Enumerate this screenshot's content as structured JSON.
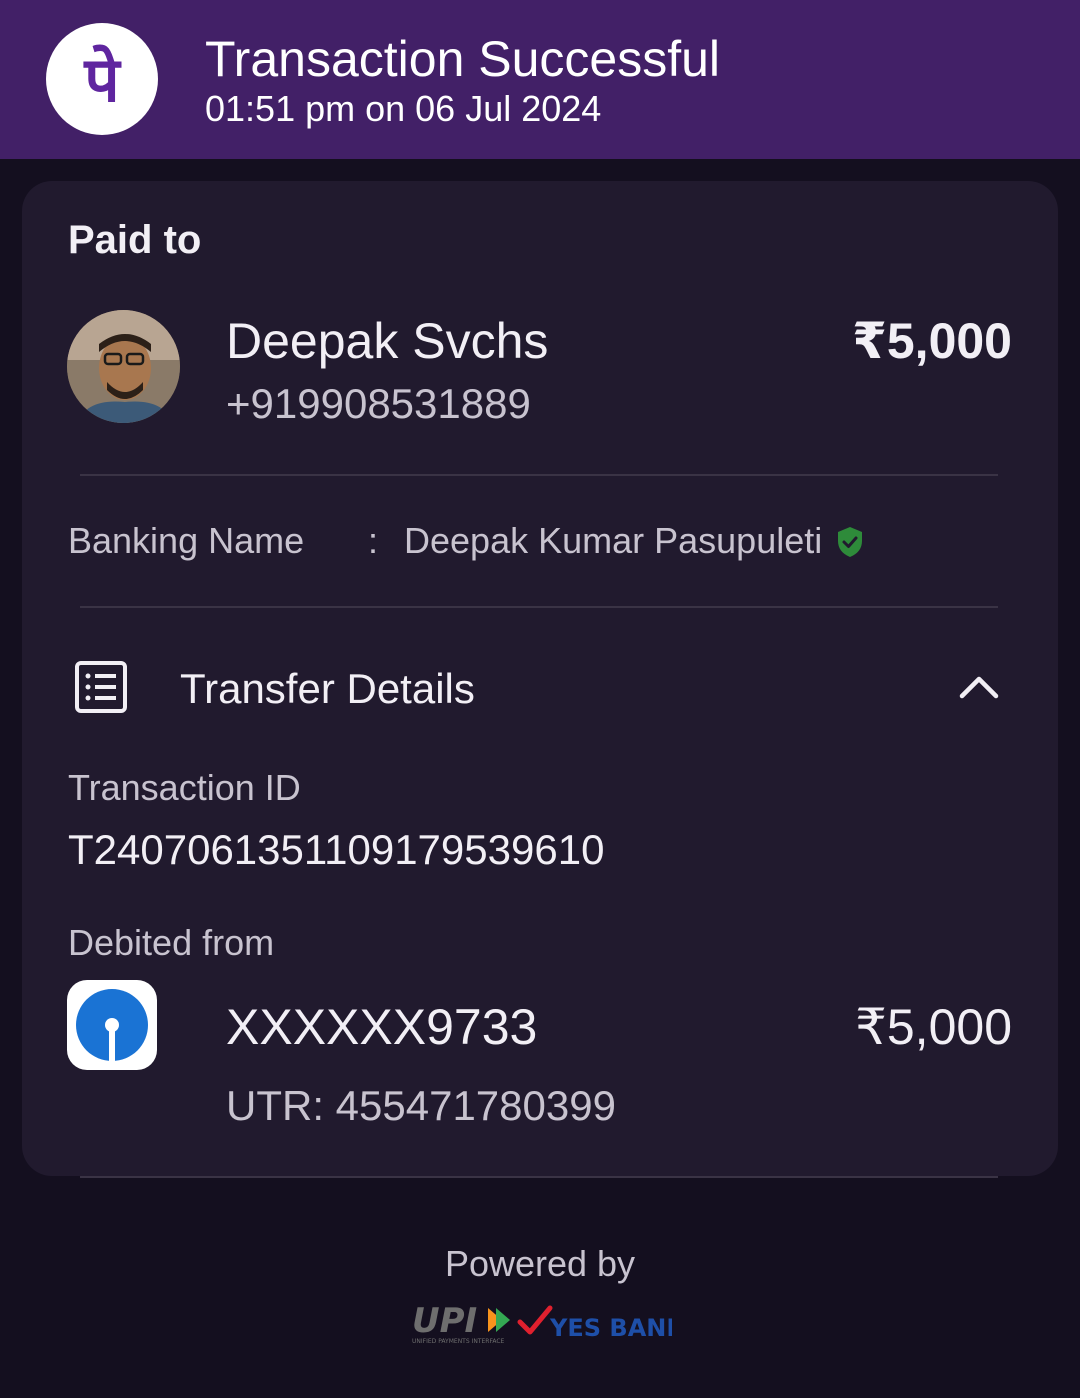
{
  "header": {
    "title": "Transaction Successful",
    "subtitle": "01:51 pm on 06 Jul 2024",
    "logo_icon": "phonepe-logo-icon",
    "logo_glyph": "पे",
    "background": "#422067"
  },
  "payee": {
    "section_label": "Paid to",
    "name": "Deepak Svchs",
    "phone": "+919908531889",
    "amount": "₹5,000"
  },
  "banking": {
    "label": "Banking Name",
    "separator": ":",
    "value": "Deepak Kumar Pasupuleti",
    "verified_icon": "verified-shield-icon"
  },
  "transfer_details": {
    "title": "Transfer Details",
    "expanded": true,
    "transaction_id_label": "Transaction ID",
    "transaction_id": "T2407061351109179539610",
    "debited_from_label": "Debited from",
    "account": "XXXXXX9733",
    "utr": "UTR: 455471780399",
    "amount": "₹5,000"
  },
  "footer": {
    "powered_by": "Powered by",
    "upi_text": "UPI",
    "upi_tagline": "UNIFIED PAYMENTS INTERFACE",
    "bank_text": "YES BANK"
  },
  "colors": {
    "accent": "#5f259f",
    "success_green": "#2e8b3a",
    "bank_blue": "#1a73d4"
  }
}
